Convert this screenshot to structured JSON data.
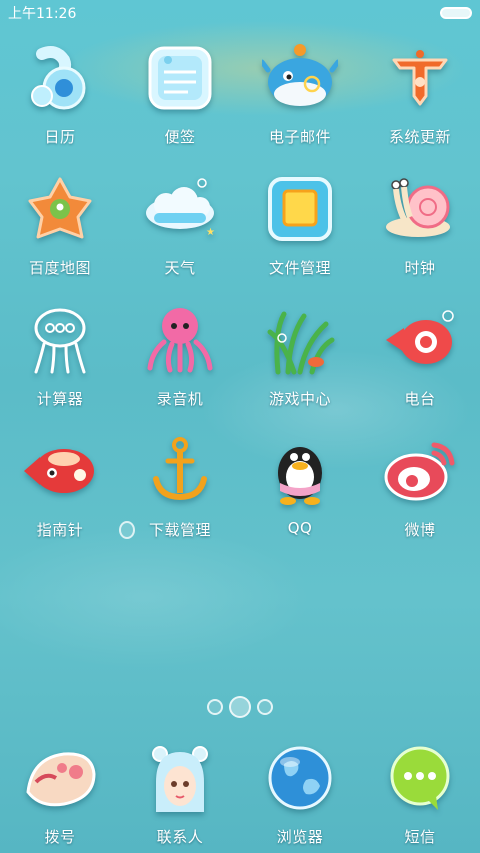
{
  "status_bar": {
    "time": "上午11:26"
  },
  "apps": [
    {
      "label": "日历",
      "icon": "calendar-icon"
    },
    {
      "label": "便签",
      "icon": "notes-icon"
    },
    {
      "label": "电子邮件",
      "icon": "email-icon"
    },
    {
      "label": "系统更新",
      "icon": "system-update-icon"
    },
    {
      "label": "百度地图",
      "icon": "baidu-map-icon"
    },
    {
      "label": "天气",
      "icon": "weather-icon"
    },
    {
      "label": "文件管理",
      "icon": "file-manager-icon"
    },
    {
      "label": "时钟",
      "icon": "clock-icon"
    },
    {
      "label": "计算器",
      "icon": "calculator-icon"
    },
    {
      "label": "录音机",
      "icon": "recorder-icon"
    },
    {
      "label": "游戏中心",
      "icon": "game-center-icon"
    },
    {
      "label": "电台",
      "icon": "radio-icon"
    },
    {
      "label": "指南针",
      "icon": "compass-icon"
    },
    {
      "label": "下载管理",
      "icon": "download-manager-icon"
    },
    {
      "label": "QQ",
      "icon": "qq-icon"
    },
    {
      "label": "微博",
      "icon": "weibo-icon"
    }
  ],
  "page_indicator": {
    "pages": 3,
    "active_index": 1
  },
  "dock": [
    {
      "label": "拨号",
      "icon": "dialer-icon"
    },
    {
      "label": "联系人",
      "icon": "contacts-icon"
    },
    {
      "label": "浏览器",
      "icon": "browser-icon"
    },
    {
      "label": "短信",
      "icon": "messages-icon"
    }
  ]
}
